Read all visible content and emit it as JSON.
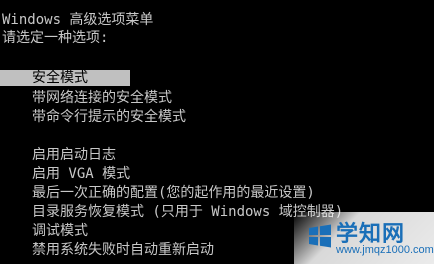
{
  "header": {
    "title": "Windows 高级选项菜单",
    "prompt": "请选定一种选项:"
  },
  "menu": {
    "safe_mode": "安全模式",
    "safe_mode_network": "带网络连接的安全模式",
    "safe_mode_cmd": "带命令行提示的安全模式",
    "boot_logging": "启用启动日志",
    "vga_mode": "启用 VGA 模式",
    "last_known_good": "最后一次正确的配置(您的起作用的最近设置)",
    "ds_restore": "目录服务恢复模式 (只用于 Windows 域控制器)",
    "debug_mode": "调试模式",
    "disable_restart": "禁用系统失败时自动重新启动"
  },
  "watermark": {
    "title": "学知网",
    "url": "www.jmqz1000.com"
  },
  "colors": {
    "background": "#000000",
    "text": "#c8c8c8",
    "highlight": "#c0c0c0",
    "watermark_blue": "#1a6fb8"
  }
}
